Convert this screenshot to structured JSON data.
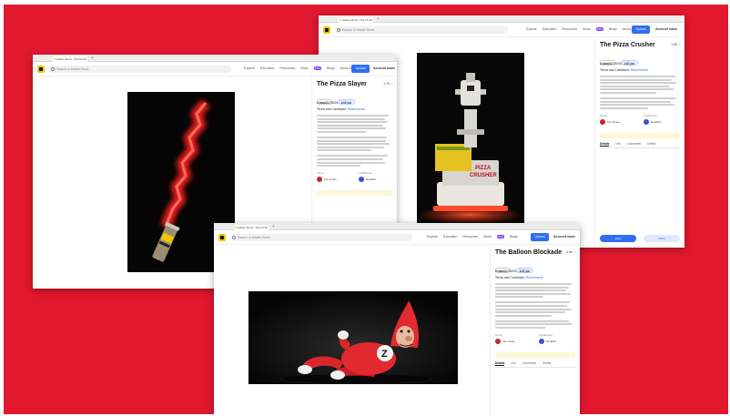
{
  "colors": {
    "background": "#e2182f",
    "accent_blue": "#2f6df6",
    "logo_yellow": "#f5c400",
    "pro_badge": "#7a3cff"
  },
  "shared_ui": {
    "tab_title": "Adobe Stock | The Pizza",
    "search_placeholder": "Search in Adobe Stock",
    "nav": [
      "Explore",
      "Education",
      "Resources",
      "Stock",
      "Blogs",
      "About Adobe",
      "Discussions"
    ],
    "pro_badge": "PRO",
    "upload_button": "Upload",
    "account_label": "Account name",
    "follow_label": "Follow",
    "hire_label": "Hire me",
    "role_owner": "Owner",
    "role_collaborator": "Collaborator",
    "license_prefix": "Terms and Conditions:",
    "license_link": "Read license",
    "tabs": [
      "Details",
      "Info",
      "Comments",
      "Similar"
    ],
    "save_button": "Save",
    "share_button": "Share"
  },
  "windows": [
    {
      "id": "pizza-slayer",
      "title": "The Pizza Slayer",
      "likes": "1.7k",
      "date": "Added 01/30/24 - 1:37 pm",
      "owner": "Tim Jones",
      "collaborator": "Noodlez"
    },
    {
      "id": "pizza-crusher",
      "title": "The Pizza Crusher",
      "likes": "1.5k",
      "date": "Added 01/30/24 - 1:37 pm",
      "owner": "Tim Jones",
      "collaborator": "Noodlez",
      "image_text_line1": "PIZZA",
      "image_text_line2": "CRUSHER"
    },
    {
      "id": "balloon-blockade",
      "title": "The Balloon Blockade",
      "likes": "1.6k",
      "date": "Added 01/30/24 - 1:37 pm",
      "owner": "Tim Jones",
      "collaborator": "Noodlez",
      "badge_letter": "Z"
    }
  ]
}
